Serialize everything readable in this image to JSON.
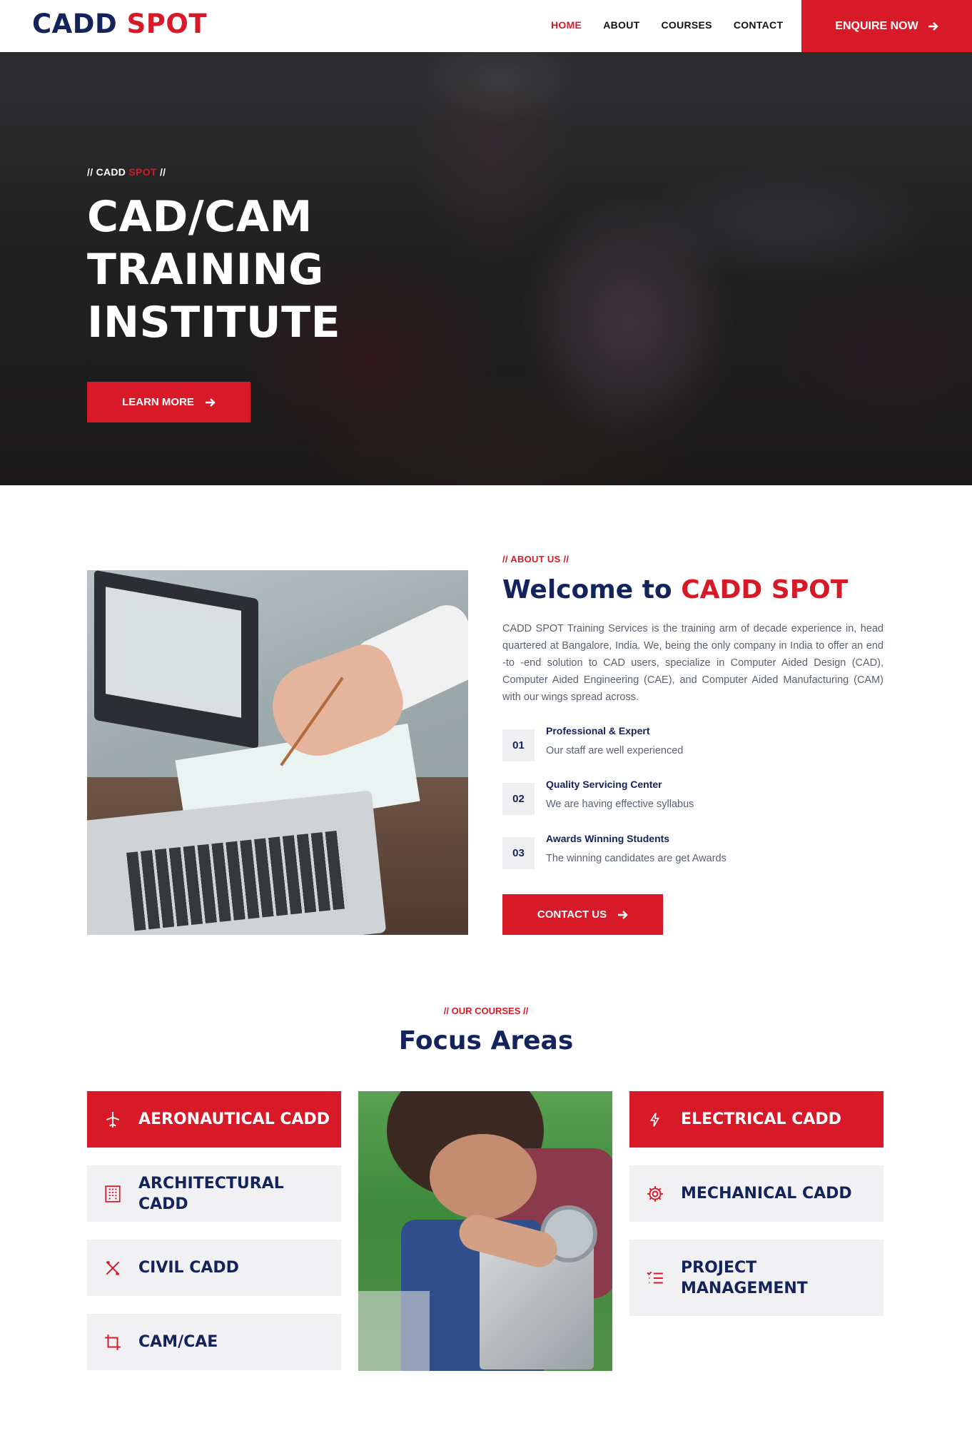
{
  "nav": {
    "logo_a": "CADD",
    "logo_b": "SPOT",
    "items": [
      {
        "label": "HOME",
        "active": true
      },
      {
        "label": "ABOUT",
        "active": false
      },
      {
        "label": "COURSES",
        "active": false
      },
      {
        "label": "CONTACT",
        "active": false
      }
    ],
    "cta": "ENQUIRE NOW"
  },
  "hero": {
    "tag_prefix": "// CADD",
    "tag_red": "SPOT",
    "tag_suffix": "//",
    "title_line1": "CAD/CAM TRAINING",
    "title_line2": "INSTITUTE",
    "button": "LEARN MORE"
  },
  "about": {
    "eyebrow": "// ABOUT US //",
    "heading_a": "Welcome to",
    "heading_b": "CADD SPOT",
    "paragraph": "CADD SPOT Training Services is the training arm of decade experience in, head quartered at Bangalore, India. We, being the only company in India to offer an end -to -end solution to CAD users, specialize in Computer Aided Design (CAD), Computer Aided Engineering (CAE), and Computer Aided Manufacturing (CAM) with our wings spread across.",
    "features": [
      {
        "num": "01",
        "title": "Professional & Expert",
        "desc": "Our staff are well experienced"
      },
      {
        "num": "02",
        "title": "Quality Servicing Center",
        "desc": "We are having effective syllabus"
      },
      {
        "num": "03",
        "title": "Awards Winning Students",
        "desc": "The winning candidates are get Awards"
      }
    ],
    "button": "CONTACT US"
  },
  "courses": {
    "eyebrow": "// OUR COURSES //",
    "heading": "Focus Areas",
    "left": [
      {
        "label": "AERONAUTICAL CADD",
        "icon": "plane-icon",
        "highlight": true
      },
      {
        "label": "ARCHITECTURAL CADD",
        "icon": "building-icon",
        "highlight": false
      },
      {
        "label": "CIVIL CADD",
        "icon": "tools-icon",
        "highlight": false
      },
      {
        "label": "CAM/CAE",
        "icon": "crop-icon",
        "highlight": false
      }
    ],
    "right": [
      {
        "label": "ELECTRICAL CADD",
        "icon": "bolt-icon",
        "highlight": true
      },
      {
        "label": "MECHANICAL CADD",
        "icon": "gear-icon",
        "highlight": false
      },
      {
        "label": "PROJECT MANAGEMENT",
        "icon": "checklist-icon",
        "highlight": false
      }
    ]
  },
  "colors": {
    "brand_red": "#d81a28",
    "brand_navy": "#13235b",
    "tile_gray": "#f1f1f3"
  }
}
